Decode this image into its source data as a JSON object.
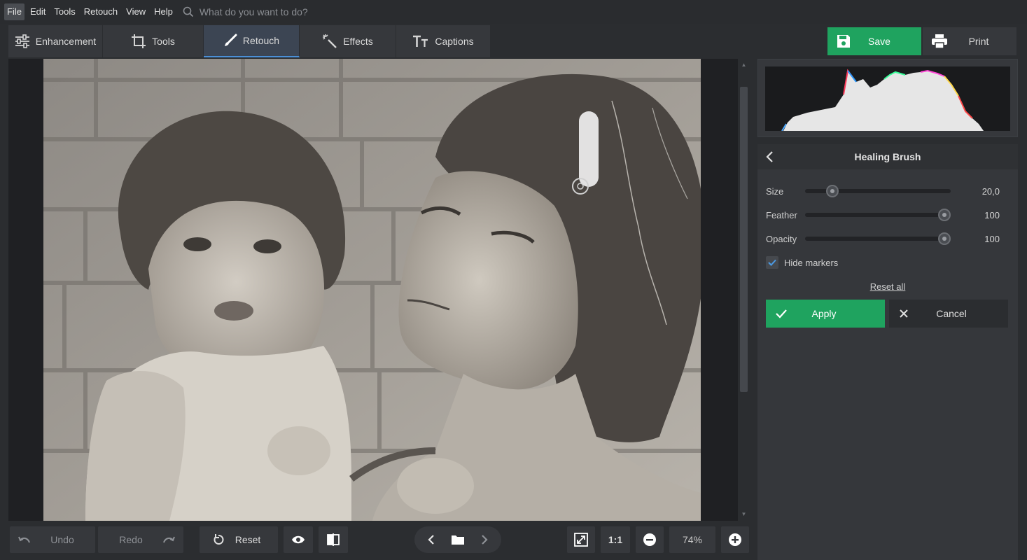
{
  "menu": {
    "items": [
      "File",
      "Edit",
      "Tools",
      "Retouch",
      "View",
      "Help"
    ],
    "search_placeholder": "What do you want to do?"
  },
  "tabs": [
    {
      "label": "Enhancement",
      "icon": "sliders-icon"
    },
    {
      "label": "Tools",
      "icon": "crop-icon"
    },
    {
      "label": "Retouch",
      "icon": "brush-icon",
      "active": true
    },
    {
      "label": "Effects",
      "icon": "magic-wand-icon"
    },
    {
      "label": "Captions",
      "icon": "text-icon"
    }
  ],
  "actions": {
    "save_label": "Save",
    "print_label": "Print"
  },
  "panel": {
    "title": "Healing Brush",
    "sliders": [
      {
        "label": "Size",
        "value": "20,0",
        "level": 0.16
      },
      {
        "label": "Feather",
        "value": "100",
        "level": 1.0
      },
      {
        "label": "Opacity",
        "value": "100",
        "level": 1.0
      }
    ],
    "hide_markers_label": "Hide markers",
    "hide_markers_checked": true,
    "reset_all_label": "Reset all",
    "apply_label": "Apply",
    "cancel_label": "Cancel"
  },
  "bottom": {
    "undo_label": "Undo",
    "redo_label": "Redo",
    "reset_label": "Reset",
    "actual_size_label": "1:1",
    "zoom_value": "74%"
  },
  "colors": {
    "accent_green": "#1fa35f",
    "active_tab_underline": "#4b8fd6",
    "background": "#2b2d30"
  }
}
